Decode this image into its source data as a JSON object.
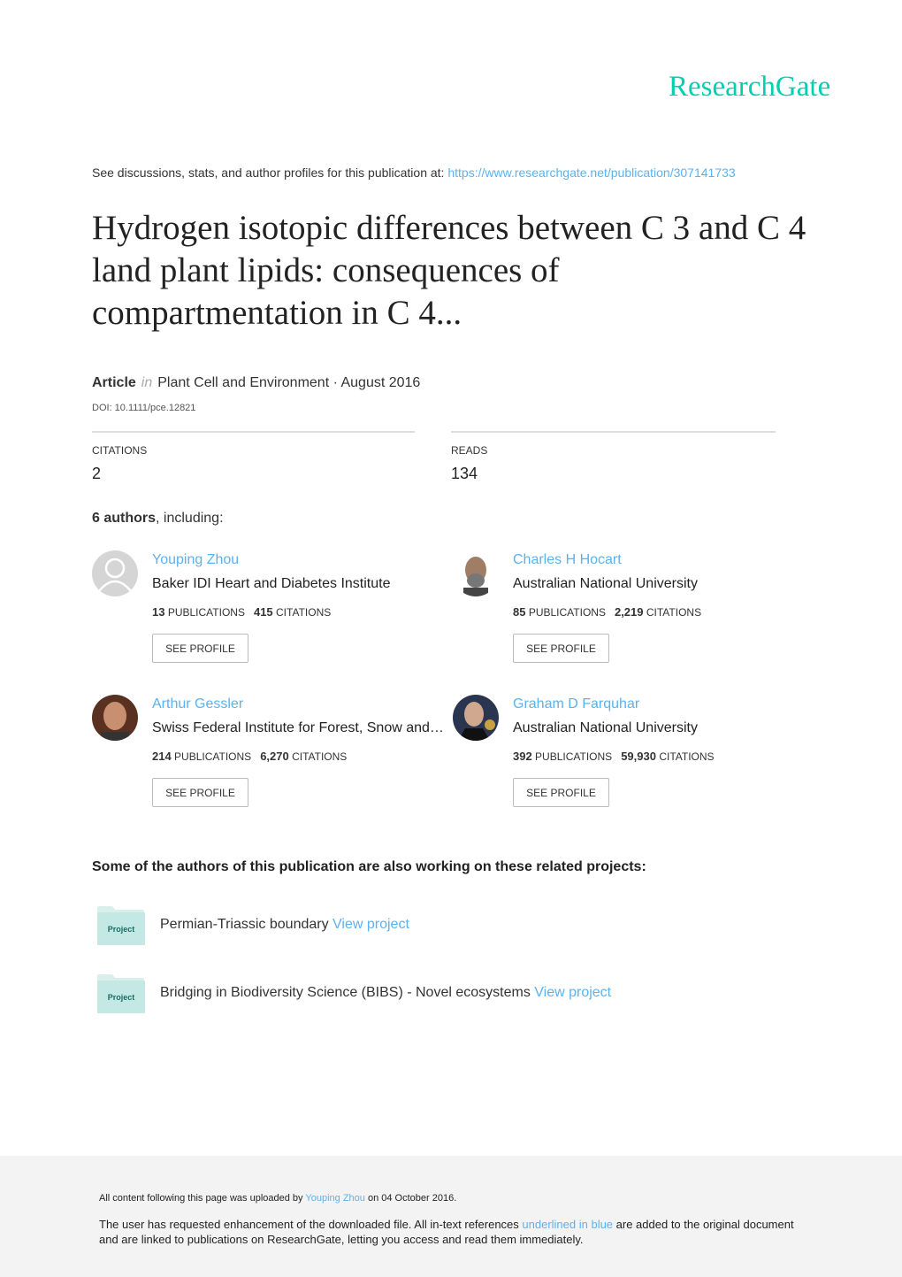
{
  "brand": {
    "logo": "ResearchGate",
    "accent": "#00d0af",
    "link_color": "#5bb2f0"
  },
  "header": {
    "intro": "See discussions, stats, and author profiles for this publication at: ",
    "url": "https://www.researchgate.net/publication/307141733"
  },
  "article": {
    "title": "Hydrogen isotopic differences between C 3 and C 4 land plant lipids: consequences of compartmentation in C 4...",
    "type": "Article",
    "in": "in",
    "journal": "Plant Cell and Environment · August 2016",
    "doi": "DOI: 10.1111/pce.12821"
  },
  "stats": {
    "citations_label": "CITATIONS",
    "citations": "2",
    "reads_label": "READS",
    "reads": "134"
  },
  "authors_heading": {
    "count": "6 authors",
    "rest": ", including:"
  },
  "authors": [
    {
      "name": "Youping Zhou",
      "institution": "Baker IDI Heart and Diabetes Institute",
      "publications": "13",
      "citations": "415",
      "avatar": "default-avatar"
    },
    {
      "name": "Charles H Hocart",
      "institution": "Australian National University",
      "publications": "85",
      "citations": "2,219",
      "avatar": "photo"
    },
    {
      "name": "Arthur Gessler",
      "institution": "Swiss Federal Institute for Forest, Snow and Landscape Research WSL",
      "publications": "214",
      "citations": "6,270",
      "avatar": "photo"
    },
    {
      "name": "Graham D Farquhar",
      "institution": "Australian National University",
      "publications": "392",
      "citations": "59,930",
      "avatar": "photo"
    }
  ],
  "labels": {
    "publications": "PUBLICATIONS",
    "citations": "CITATIONS",
    "see_profile": "SEE PROFILE"
  },
  "projects_heading": "Some of the authors of this publication are also working on these related projects:",
  "projects": [
    {
      "icon_label": "Project",
      "name": "Permian-Triassic boundary ",
      "link": "View project"
    },
    {
      "icon_label": "Project",
      "name": "Bridging in Biodiversity Science (BIBS) - Novel ecosystems ",
      "link": "View project"
    }
  ],
  "footer": {
    "upload_pre": "All content following this page was uploaded by ",
    "uploader": "Youping Zhou",
    "upload_post": " on 04 October 2016.",
    "note_pre": "The user has requested enhancement of the downloaded file. All in-text references ",
    "note_link": "underlined in blue",
    "note_post": " are added to the original document and are linked to publications on ResearchGate, letting you access and read them immediately."
  }
}
